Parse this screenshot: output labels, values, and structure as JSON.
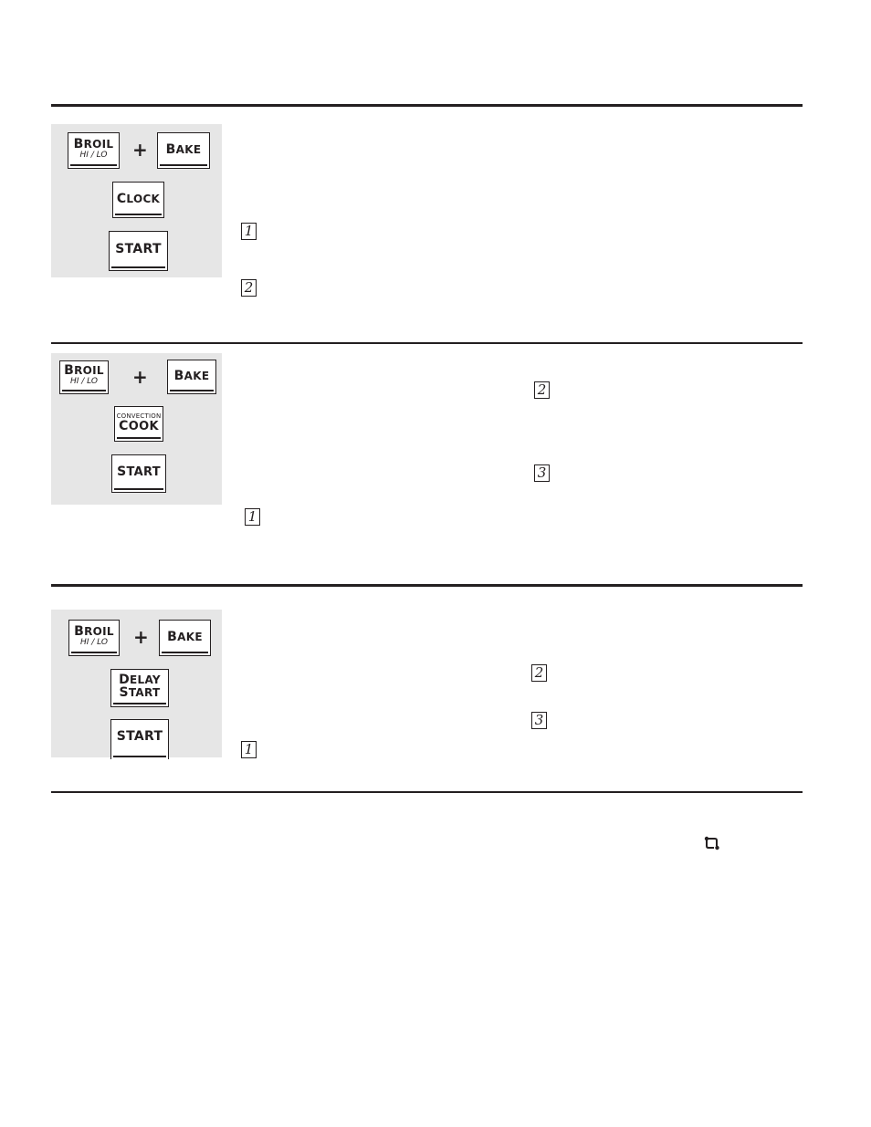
{
  "sections": [
    {
      "keys": {
        "broil": {
          "main": "Broil",
          "sub": "Hi/Lo"
        },
        "plus": "+",
        "bake": "Bake",
        "middle": {
          "main": "Clock"
        },
        "start": "Start"
      },
      "steps": [
        "1",
        "2"
      ]
    },
    {
      "keys": {
        "broil": {
          "main": "Broil",
          "sub": "Hi/Lo"
        },
        "plus": "+",
        "bake": "Bake",
        "middle": {
          "top": "Convection",
          "main": "Cook"
        },
        "start": "Start"
      },
      "steps": [
        "1",
        "2",
        "3"
      ]
    },
    {
      "keys": {
        "broil": {
          "main": "Broil",
          "sub": "Hi/Lo"
        },
        "plus": "+",
        "bake": "Bake",
        "middle": {
          "main": "Delay",
          "main2": "Start"
        },
        "start": "Start"
      },
      "steps": [
        "1",
        "2",
        "3"
      ]
    }
  ],
  "footer_icon": "loop-icon"
}
